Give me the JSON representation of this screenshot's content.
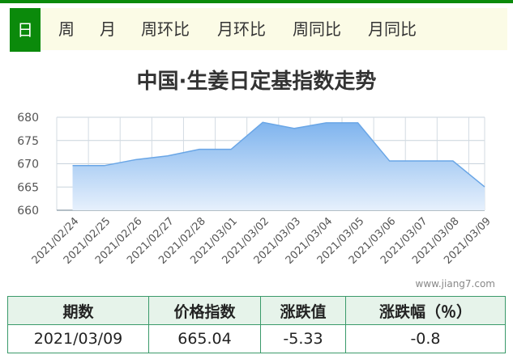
{
  "tabs": [
    {
      "label": "日",
      "active": true
    },
    {
      "label": "周",
      "active": false
    },
    {
      "label": "月",
      "active": false
    },
    {
      "label": "周环比",
      "active": false
    },
    {
      "label": "月环比",
      "active": false
    },
    {
      "label": "周同比",
      "active": false
    },
    {
      "label": "月同比",
      "active": false
    }
  ],
  "colors": {
    "accent": "#0b8a0b",
    "tab_bg": "#fbfbe6",
    "area_top": "#7fb4ee",
    "area_bottom": "#e6f0fc",
    "line": "#6aa6e6",
    "table_header": "#e6f3ea",
    "table_border": "#3a9a6a"
  },
  "watermark": "www.jiang7.com",
  "chart_data": {
    "type": "area",
    "title": "中国·生姜日定基指数走势",
    "xlabel": "",
    "ylabel": "",
    "ylim": [
      660,
      680
    ],
    "yticks": [
      660,
      665,
      670,
      675,
      680
    ],
    "grid": true,
    "categories": [
      "2021/02/24",
      "2021/02/25",
      "2021/02/26",
      "2021/02/27",
      "2021/02/28",
      "2021/03/01",
      "2021/03/02",
      "2021/03/03",
      "2021/03/04",
      "2021/03/05",
      "2021/03/06",
      "2021/03/07",
      "2021/03/08",
      "2021/03/09"
    ],
    "series": [
      {
        "values": [
          669.6,
          669.6,
          670.9,
          671.7,
          673.1,
          673.1,
          678.9,
          677.6,
          678.8,
          678.8,
          670.6,
          670.6,
          670.6,
          665.04
        ]
      }
    ]
  },
  "table": {
    "headers": [
      "期数",
      "价格指数",
      "涨跌值",
      "涨跌幅（％）"
    ],
    "rows": [
      [
        "2021/03/09",
        "665.04",
        "-5.33",
        "-0.8"
      ]
    ]
  }
}
